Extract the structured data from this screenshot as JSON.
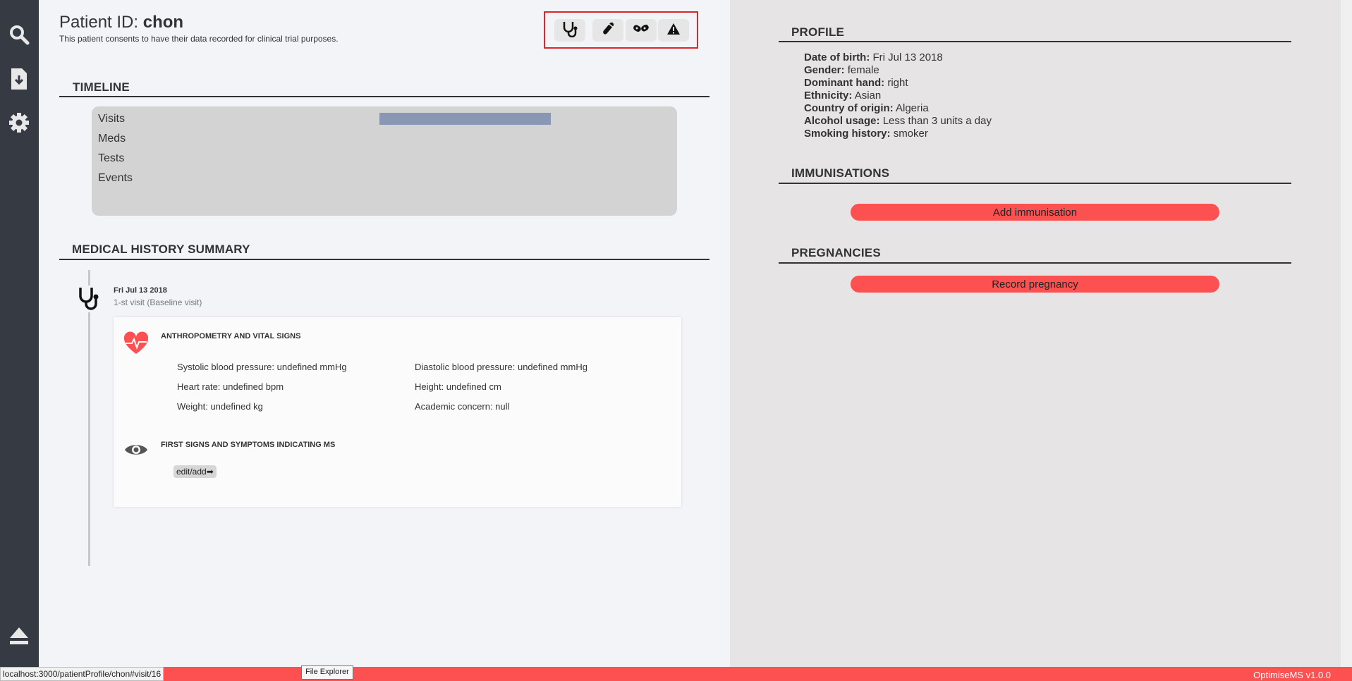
{
  "header": {
    "title_prefix": "Patient ID: ",
    "patient_id": "chon",
    "consent": "This patient consents to have their data recorded for clinical trial purposes."
  },
  "sidebar": {
    "items": [
      {
        "icon": "search-icon"
      },
      {
        "icon": "download-icon"
      },
      {
        "icon": "gear-icon"
      },
      {
        "icon": "eject-icon"
      }
    ]
  },
  "toolbar": {
    "buttons": [
      {
        "icon": "stethoscope-icon"
      },
      {
        "icon": "test-tube-icon"
      },
      {
        "icon": "pills-icon"
      },
      {
        "icon": "warning-icon"
      }
    ]
  },
  "timeline": {
    "heading": "TIMELINE",
    "rows": [
      "Visits",
      "Meds",
      "Tests",
      "Events"
    ],
    "visits_bar_color": "#8897b3"
  },
  "medical_history": {
    "heading": "MEDICAL HISTORY SUMMARY",
    "visit": {
      "date": "Fri Jul 13 2018",
      "subtitle": "1-st visit (Baseline visit)",
      "sections": [
        {
          "icon": "heartbeat-icon",
          "title": "ANTHROPOMETRY AND VITAL SIGNS",
          "values": [
            "Systolic blood pressure: undefined mmHg",
            "Diastolic blood pressure: undefined mmHg",
            "Heart rate: undefined bpm",
            "Height: undefined cm",
            "Weight: undefined kg",
            "Academic concern: null"
          ]
        },
        {
          "icon": "eye-icon",
          "title": "FIRST SIGNS AND SYMPTOMS INDICATING MS",
          "edit_label": "edit/add➡"
        }
      ]
    }
  },
  "profile": {
    "heading": "PROFILE",
    "fields": [
      {
        "label": "Date of birth:",
        "value": "Fri Jul 13 2018"
      },
      {
        "label": "Gender:",
        "value": "female"
      },
      {
        "label": "Dominant hand:",
        "value": "right"
      },
      {
        "label": "Ethnicity:",
        "value": "Asian"
      },
      {
        "label": "Country of origin:",
        "value": "Algeria"
      },
      {
        "label": "Alcohol usage:",
        "value": "Less than 3 units a day"
      },
      {
        "label": "Smoking history:",
        "value": "smoker"
      }
    ]
  },
  "immunisations": {
    "heading": "IMMUNISATIONS",
    "button": "Add immunisation"
  },
  "pregnancies": {
    "heading": "PREGNANCIES",
    "button": "Record pregnancy"
  },
  "statusbar": {
    "url": "localhost:3000/patientProfile/chon#visit/16",
    "tooltip": "File Explorer",
    "version": "OptimiseMS v1.0.0"
  },
  "colors": {
    "sidebar": "#363a43",
    "accent_red": "#fd5151",
    "highlight_border": "#e0242c"
  }
}
